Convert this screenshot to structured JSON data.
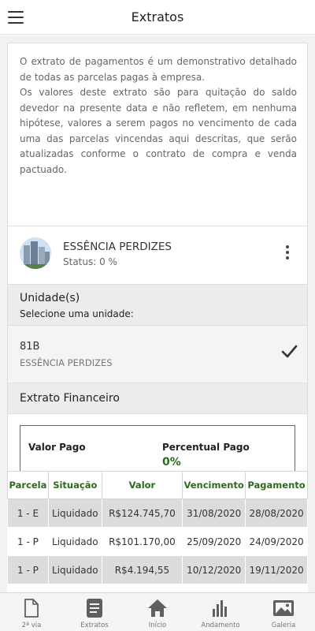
{
  "header": {
    "title": "Extratos",
    "menu_icon": "hamburger-menu-icon"
  },
  "intro": {
    "paragraph1": "O extrato de pagamentos é um demonstrativo detalhado de todas as parcelas pagas à empresa.",
    "paragraph2": "Os valores deste extrato são para quitação do saldo devedor na presente data e não refletem, em nenhuma hipótese, valores a serem pagos no vencimento de cada uma das parcelas vincendas aqui descritas, que serão atualizadas conforme o contrato de compra e venda pactuado."
  },
  "building": {
    "name": "ESSÊNCIA PERDIZES",
    "status": "Status: 0 %",
    "more_icon": "more-vertical-icon"
  },
  "units": {
    "title": "Unidade(s)",
    "subtitle": "Selecione uma unidade:",
    "selected": {
      "code": "81B",
      "name": "ESSÊNCIA PERDIZES"
    }
  },
  "extrato": {
    "title": "Extrato Financeiro",
    "valor_pago_label": "Valor Pago",
    "percentual_label": "Percentual Pago",
    "percentual_value": "0%"
  },
  "table": {
    "headers": [
      "Parcela",
      "Situação",
      "Valor",
      "Vencimento",
      "Pagamento"
    ],
    "rows": [
      [
        "1 - E",
        "Liquidado",
        "R$124.745,70",
        "31/08/2020",
        "28/08/2020"
      ],
      [
        "1 - P",
        "Liquidado",
        "R$101.170,00",
        "25/09/2020",
        "24/09/2020"
      ],
      [
        "1 - P",
        "Liquidado",
        "R$4.194,55",
        "10/12/2020",
        "19/11/2020"
      ],
      [
        "",
        "",
        "",
        "",
        ""
      ]
    ]
  },
  "tabs": [
    {
      "label": "2ª via",
      "icon": "document-icon"
    },
    {
      "label": "Extratos",
      "icon": "statement-icon"
    },
    {
      "label": "Início",
      "icon": "home-icon"
    },
    {
      "label": "Andamento",
      "icon": "bar-chart-icon"
    },
    {
      "label": "Galeria",
      "icon": "gallery-icon"
    }
  ],
  "colors": {
    "accent_green": "#2d6a1a",
    "tab_icon": "#5f5f5f"
  }
}
